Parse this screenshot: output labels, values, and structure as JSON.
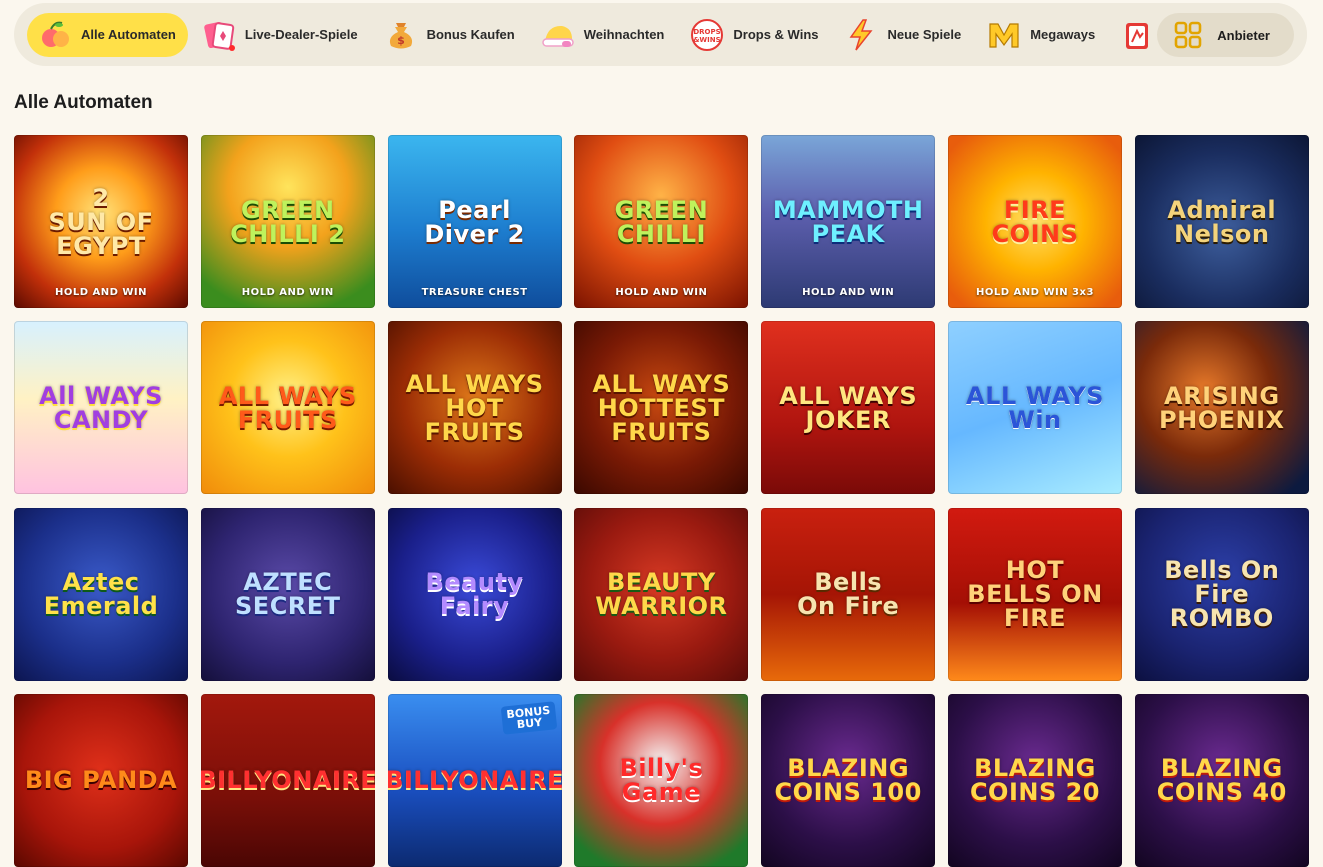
{
  "nav": {
    "items": [
      {
        "label": "Alle Automaten",
        "icon": "fruit-slot-icon",
        "active": true
      },
      {
        "label": "Live-Dealer-Spiele",
        "icon": "live-cards-icon",
        "active": false
      },
      {
        "label": "Bonus Kaufen",
        "icon": "money-bag-icon",
        "active": false
      },
      {
        "label": "Weihnachten",
        "icon": "santa-hat-icon",
        "active": false
      },
      {
        "label": "Drops & Wins",
        "icon": "drops-wins-icon",
        "active": false,
        "icon_text": "DROPS &WINS"
      },
      {
        "label": "Neue Spiele",
        "icon": "lightning-icon",
        "active": false
      },
      {
        "label": "Megaways",
        "icon": "megaways-icon",
        "active": false
      }
    ],
    "providers_label": "Anbieter",
    "accent": "#ffe048"
  },
  "section": {
    "title": "Alle Automaten"
  },
  "games": [
    {
      "title": "2\nSUN OF EGYPT",
      "subtitle": "HOLD AND WIN"
    },
    {
      "title": "GREEN\nCHILLI 2",
      "subtitle": "HOLD AND WIN"
    },
    {
      "title": "Pearl\nDiver 2",
      "subtitle": "TREASURE CHEST"
    },
    {
      "title": "GREEN CHILLI",
      "subtitle": "HOLD AND WIN"
    },
    {
      "title": "MAMMOTH\nPEAK",
      "subtitle": "HOLD AND WIN"
    },
    {
      "title": "FIRE\nCOINS",
      "subtitle": "HOLD AND WIN 3x3"
    },
    {
      "title": "Admiral Nelson",
      "subtitle": ""
    },
    {
      "title": "All WAYS\nCANDY",
      "subtitle": ""
    },
    {
      "title": "ALL WAYS\nFRUITS",
      "subtitle": ""
    },
    {
      "title": "ALL WAYS\nHOT FRUITS",
      "subtitle": ""
    },
    {
      "title": "ALL WAYS\nHOTTEST\nFRUITS",
      "subtitle": ""
    },
    {
      "title": "ALL WAYS\nJOKER",
      "subtitle": ""
    },
    {
      "title": "ALL WAYS\nWin",
      "subtitle": ""
    },
    {
      "title": "ARISING\nPHOENIX",
      "subtitle": ""
    },
    {
      "title": "Aztec Emerald",
      "subtitle": ""
    },
    {
      "title": "AZTEC\nSECRET",
      "subtitle": ""
    },
    {
      "title": "Beauty Fairy",
      "subtitle": ""
    },
    {
      "title": "BEAUTY\nWARRIOR",
      "subtitle": ""
    },
    {
      "title": "Bells\nOn Fire",
      "subtitle": ""
    },
    {
      "title": "HOT\nBELLS ON FIRE",
      "subtitle": ""
    },
    {
      "title": "Bells On Fire\nROMBO",
      "subtitle": ""
    },
    {
      "title": "BIG PANDA",
      "subtitle": ""
    },
    {
      "title": "BILLYONAIRE",
      "subtitle": ""
    },
    {
      "title": "BILLYONAIRE",
      "subtitle": "",
      "badge": "BONUS\nBUY"
    },
    {
      "title": "Billy's Game",
      "subtitle": ""
    },
    {
      "title": "BLAZING\nCOINS 100",
      "subtitle": ""
    },
    {
      "title": "BLAZING\nCOINS 20",
      "subtitle": ""
    },
    {
      "title": "BLAZING\nCOINS 40",
      "subtitle": ""
    }
  ]
}
